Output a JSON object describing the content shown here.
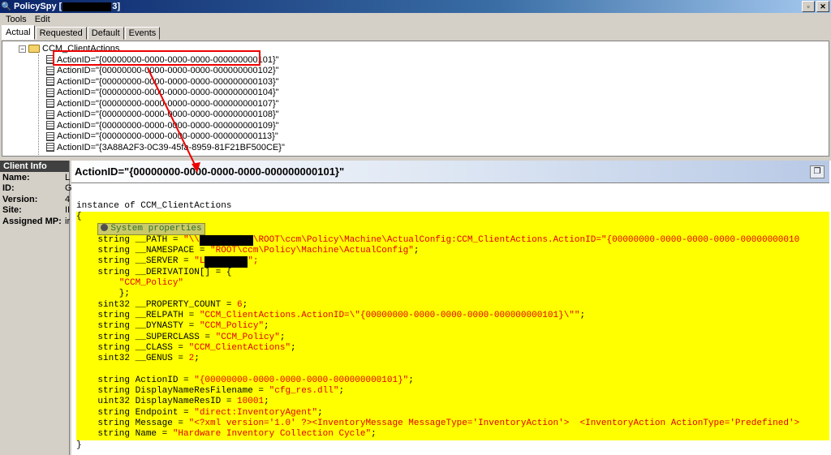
{
  "window": {
    "title_prefix": "PolicySpy [",
    "title_suffix": "3]",
    "buttons": {
      "restore": "▫",
      "close": "✕"
    }
  },
  "menu": [
    "Tools",
    "Edit"
  ],
  "tabs": [
    "Actual",
    "Requested",
    "Default",
    "Events"
  ],
  "tree": {
    "root": "CCM_ClientActions",
    "items": [
      "ActionID=\"{00000000-0000-0000-0000-000000000101}\"",
      "ActionID=\"{00000000-0000-0000-0000-000000000102}\"",
      "ActionID=\"{00000000-0000-0000-0000-000000000103}\"",
      "ActionID=\"{00000000-0000-0000-0000-000000000104}\"",
      "ActionID=\"{00000000-0000-0000-0000-000000000107}\"",
      "ActionID=\"{00000000-0000-0000-0000-000000000108}\"",
      "ActionID=\"{00000000-0000-0000-0000-000000000109}\"",
      "ActionID=\"{00000000-0000-0000-0000-000000000113}\"",
      "ActionID=\"{3A88A2F3-0C39-45fa-8959-81F21BF500CE}\""
    ]
  },
  "client_info": {
    "header": "Client Info",
    "rows": [
      {
        "label": "Name:",
        "value": "L"
      },
      {
        "label": "ID:",
        "value": "G"
      },
      {
        "label": "Version:",
        "value": "4"
      },
      {
        "label": "Site:",
        "value": "II"
      },
      {
        "label": "Assigned MP:",
        "value": "ir"
      }
    ]
  },
  "detail": {
    "header": "ActionID=\"{00000000-0000-0000-0000-000000000101}\"",
    "system_properties_label": "System properties",
    "lines": {
      "instance": "instance of CCM_ClientActions",
      "open": "{",
      "path_a": "    string __PATH = ",
      "path_b": "\"\\\\",
      "path_c": "\\ROOT\\ccm\\Policy\\Machine\\ActualConfig:CCM_ClientActions.ActionID=\"{00000000-0000-0000-0000-00000000010",
      "namespace_a": "    string __NAMESPACE = ",
      "namespace_b": "\"ROOT\\ccm\\Policy\\Machine\\ActualConfig\"",
      "server_a": "    string __SERVER = ",
      "server_b": "\"L",
      "server_c": "\";",
      "derivation_a": "    string __DERIVATION[] = {",
      "derivation_b": "        \"CCM_Policy\"",
      "derivation_c": "        };",
      "propcount_a": "    sint32 __PROPERTY_COUNT = ",
      "propcount_b": "6",
      "relpath_a": "    string __RELPATH = ",
      "relpath_b": "\"CCM_ClientActions.ActionID=\\\"{00000000-0000-0000-0000-000000000101}\\\"\"",
      "dynasty_a": "    string __DYNASTY = ",
      "dynasty_b": "\"CCM_Policy\"",
      "superclass_a": "    string __SUPERCLASS = ",
      "superclass_b": "\"CCM_Policy\"",
      "class_a": "    string __CLASS = ",
      "class_b": "\"CCM_ClientActions\"",
      "genus_a": "    sint32 __GENUS = ",
      "genus_b": "2",
      "actionid_a": "    string ActionID = ",
      "actionid_b": "\"{00000000-0000-0000-0000-000000000101}\"",
      "resfile_a": "    string DisplayNameResFilename = ",
      "resfile_b": "\"cfg_res.dll\"",
      "resid_a": "    uint32 DisplayNameResID = ",
      "resid_b": "10001",
      "endpoint_a": "    string Endpoint = ",
      "endpoint_b": "\"direct:InventoryAgent\"",
      "message_a": "    string Message = ",
      "message_b": "\"<?xml version='1.0' ?><InventoryMessage MessageType='InventoryAction'>  <InventoryAction ActionType='Predefined'>",
      "name_a": "    string Name = ",
      "name_b": "\"Hardware Inventory Collection Cycle\"",
      "close": "}"
    }
  }
}
